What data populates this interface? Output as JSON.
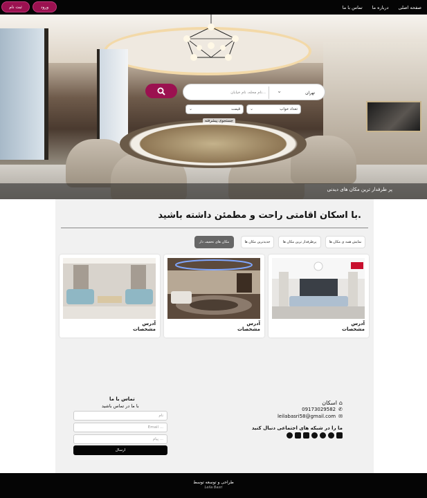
{
  "nav": {
    "links": [
      "صفحه اصلی",
      "درباره ما",
      "تماس با ما"
    ],
    "login_label": "ورود",
    "signup_label": "ثبت نام"
  },
  "hero": {
    "caption": "پر طرفدار ترین مکان های دیدنی",
    "search": {
      "city": "تهران",
      "placeholder": "نام محله، نام خیابان...",
      "bedrooms_label": "تعداد خواب",
      "price_label": "قیمت",
      "advanced_label": "جستجوی پیشرفته"
    }
  },
  "main": {
    "slogan": "با اسکان اقامتی راحت و مطمئن داشته باشید.",
    "tabs": [
      {
        "label": "نمایش همه ی مکان ها",
        "active": false
      },
      {
        "label": "پرطرفدار ترین مکان ها",
        "active": false
      },
      {
        "label": "جدیدترین مکان ها",
        "active": false
      },
      {
        "label": "مکان های تخفیف دار",
        "active": true
      }
    ],
    "cards": [
      {
        "address": "آدرس",
        "specs": "مشخصات"
      },
      {
        "address": "آدرس",
        "specs": "مشخصات"
      },
      {
        "address": "آدرس",
        "specs": "مشخصات"
      }
    ]
  },
  "contact_info": {
    "brand": "اسکان",
    "phone": "09173029582",
    "email": "leilabasri58@gmail.com",
    "social_title": "ما را در شبکه های اجتماعی دنبال کنید",
    "social_icons": [
      "facebook-icon",
      "instagram-icon",
      "snapchat-icon",
      "pinterest-icon",
      "twitter-icon",
      "linkedin-icon",
      "telegram-icon"
    ]
  },
  "contact_form": {
    "title": "تماس با ما",
    "subtitle": "با ما در تماس باشید",
    "name_placeholder": "نام",
    "email_placeholder": "Email ...",
    "message_placeholder": "پیام ...",
    "send_label": "ارسال"
  },
  "footer": {
    "line1": "طراحی و توسعه توسط",
    "line2": "Leila Basri"
  },
  "colors": {
    "accent": "#9b1150",
    "dark": "#050505",
    "panel": "#f1f1f1"
  }
}
